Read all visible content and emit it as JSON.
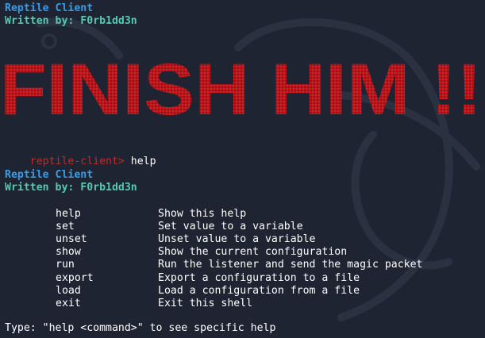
{
  "window": {
    "background": "#1e2431",
    "accent_red": "#e01c22"
  },
  "banner_top": {
    "title": "Reptile Client",
    "author": "Written by: F0rb1dd3n"
  },
  "finish_banner": {
    "text": "FINISH HIM !!",
    "color": "#e01c22"
  },
  "prompt": {
    "label": "reptile-client>",
    "command": " help"
  },
  "banner_second": {
    "title": "Reptile Client",
    "author": "Written by: F0rb1dd3n"
  },
  "help_table": [
    {
      "command": "help",
      "description": "Show this help"
    },
    {
      "command": "set",
      "description": "Set value to a variable"
    },
    {
      "command": "unset",
      "description": "Unset value to a variable"
    },
    {
      "command": "show",
      "description": "Show the current configuration"
    },
    {
      "command": "run",
      "description": "Run the listener and send the magic packet"
    },
    {
      "command": "export",
      "description": "Export a configuration to a file"
    },
    {
      "command": "load",
      "description": "Load a configuration from a file"
    },
    {
      "command": "exit",
      "description": "Exit this shell"
    }
  ],
  "footer": {
    "hint": "Type: \"help <command>\" to see specific help"
  }
}
